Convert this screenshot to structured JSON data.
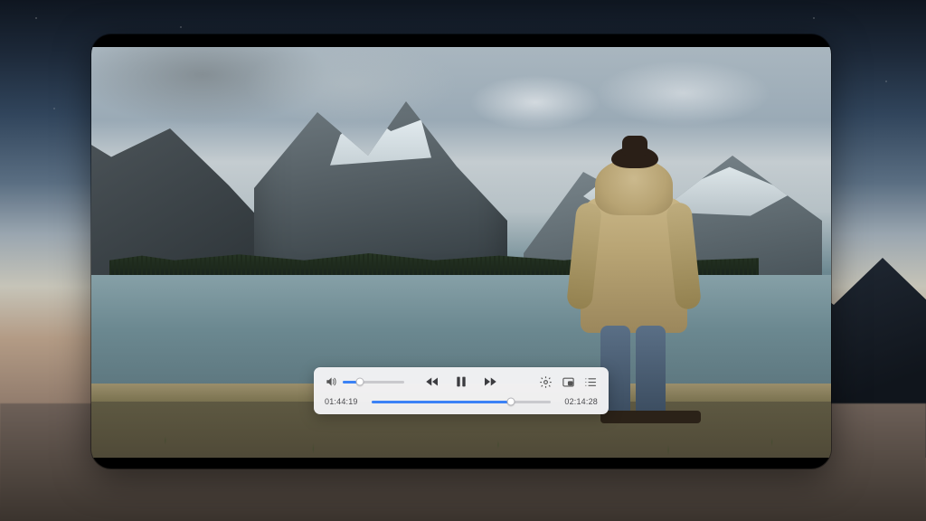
{
  "player": {
    "elapsed": "01:44:19",
    "duration": "02:14:28",
    "progress_percent": 77.6,
    "volume_percent": 28,
    "state": "playing",
    "colors": {
      "accent": "#3b82f6",
      "track": "#c9c9cd",
      "panel": "rgba(244,244,246,.96)"
    },
    "icons": {
      "volume": "volume-icon",
      "rewind": "rewind-icon",
      "pause": "pause-icon",
      "forward": "forward-icon",
      "settings": "gear-icon",
      "pip": "picture-in-picture-icon",
      "playlist": "playlist-icon"
    }
  }
}
